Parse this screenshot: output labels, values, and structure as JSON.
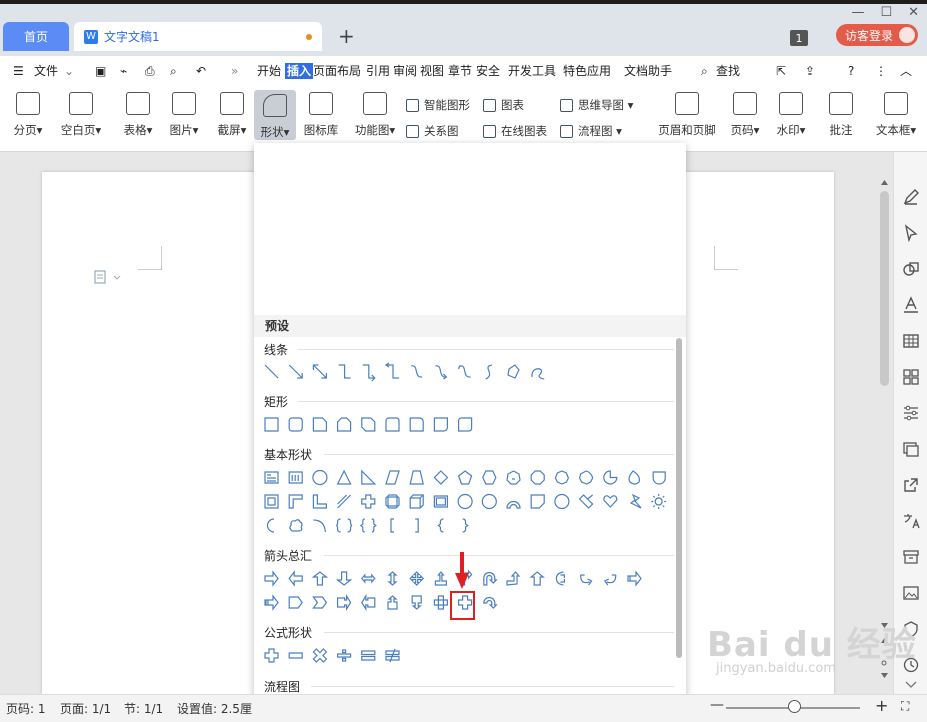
{
  "tabs": {
    "home": "首页",
    "doc": "文字文稿1",
    "new": "+"
  },
  "window": {
    "badge": "1",
    "login": "访客登录"
  },
  "menu": {
    "file": "文件",
    "items": [
      "开始",
      "插入",
      "页面布局",
      "引用",
      "审阅",
      "视图",
      "章节",
      "安全",
      "开发工具",
      "特色应用",
      "文档助手"
    ],
    "active_index": 1,
    "search": "查找"
  },
  "ribbon": {
    "big": [
      {
        "label": "分页",
        "caret": true
      },
      {
        "label": "空白页",
        "caret": true
      },
      {
        "label": "表格",
        "caret": true
      },
      {
        "label": "图片",
        "caret": true
      },
      {
        "label": "截屏",
        "caret": true
      },
      {
        "label": "形状",
        "caret": true
      },
      {
        "label": "图标库",
        "caret": false
      },
      {
        "label": "功能图",
        "caret": true
      }
    ],
    "small": [
      {
        "label": "智能图形"
      },
      {
        "label": "图表"
      },
      {
        "label": "思维导图",
        "caret": true
      },
      {
        "label": "关系图"
      },
      {
        "label": "在线图表"
      },
      {
        "label": "流程图",
        "caret": true
      }
    ],
    "right": [
      {
        "label": "页眉和页脚"
      },
      {
        "label": "页码",
        "caret": true
      },
      {
        "label": "水印",
        "caret": true
      },
      {
        "label": "批注"
      },
      {
        "label": "文本框",
        "caret": true
      }
    ]
  },
  "shape_panel": {
    "preset": "预设",
    "sections": [
      "线条",
      "矩形",
      "基本形状",
      "箭头总汇",
      "公式形状",
      "流程图"
    ]
  },
  "statusbar": {
    "page_no": "页码: 1",
    "pages": "页面: 1/1",
    "section": "节: 1/1",
    "setting": "设置值: 2.5厘"
  },
  "watermark": {
    "main": "Bai du 经验",
    "sub": "jingyan.baidu.com"
  },
  "colors": {
    "accent": "#2f6fe0",
    "home_tab": "#5b8cf5",
    "login": "#e25b4b",
    "highlight": "#e02020",
    "shape_stroke": "#4a7fc1"
  }
}
